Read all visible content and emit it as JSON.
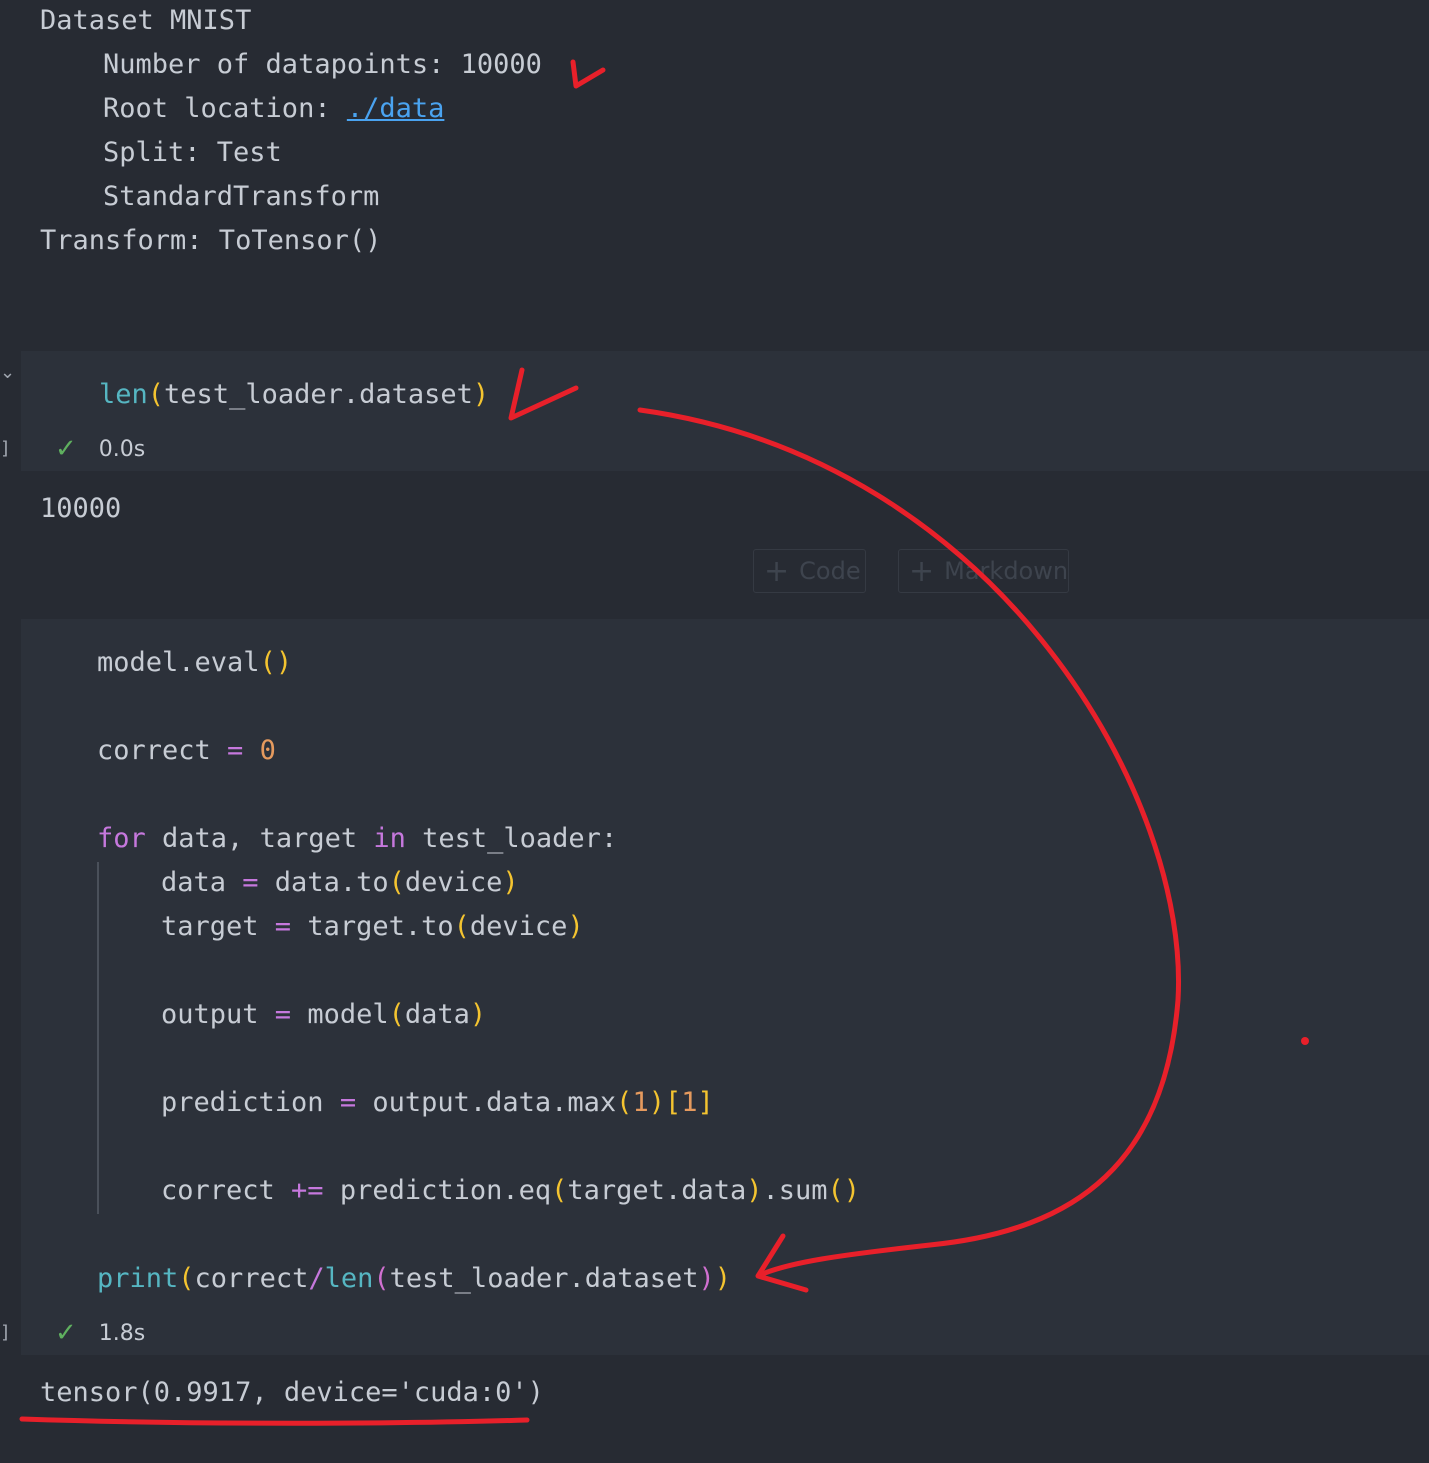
{
  "output_top": {
    "line1": "Dataset MNIST",
    "line2": "Number of datapoints: 10000",
    "line3_label": "Root location: ",
    "line3_link": "./data",
    "line4": "Split: Test",
    "line5": "StandardTransform",
    "line6": "Transform: ToTensor()"
  },
  "cell1": {
    "code": {
      "fn": "len",
      "open": "(",
      "arg": "test_loader.dataset",
      "close": ")"
    },
    "status_time": "0.0s",
    "output": "10000"
  },
  "add_buttons": {
    "code_label": "Code",
    "markdown_label": "Markdown"
  },
  "cell2": {
    "status_time": "1.8s",
    "output": "tensor(0.9917, device='cuda:0')"
  },
  "colors": {
    "background": "#272b33",
    "cell_background": "#2c313a",
    "annotation": "#e8202a",
    "check": "#5fb05f",
    "link": "#4aa3f0"
  },
  "icons": {
    "check": "check-icon",
    "chevron": "chevron-down-icon",
    "plus": "plus-icon"
  }
}
